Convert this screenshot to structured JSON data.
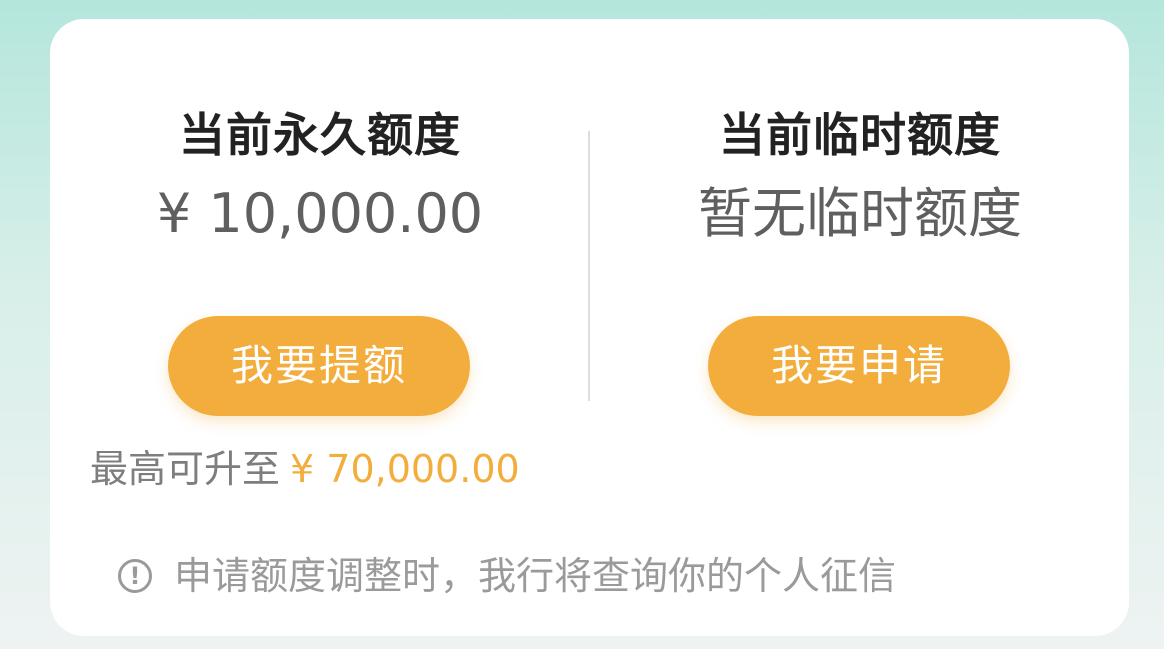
{
  "permanent": {
    "title": "当前永久额度",
    "value": "¥ 10,000.00",
    "button_label": "我要提额",
    "max_label": "最高可升至",
    "max_value": "¥ 70,000.00"
  },
  "temporary": {
    "title": "当前临时额度",
    "value": "暂无临时额度",
    "button_label": "我要申请"
  },
  "notice": {
    "icon": "info-circle-icon",
    "icon_glyph": "!",
    "text": "申请额度调整时，我行将查询你的个人征信"
  },
  "colors": {
    "accent": "#f2ad3c",
    "title": "#222222",
    "value": "#5f5f5f",
    "muted": "#9a9a9a",
    "background_top": "#b4e6dc"
  }
}
